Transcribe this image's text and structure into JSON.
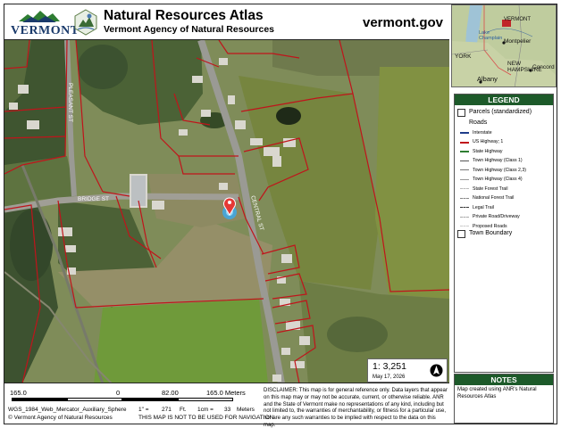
{
  "header": {
    "logo_text": "VERMONT",
    "title": "Natural Resources Atlas",
    "subtitle": "Vermont Agency of Natural Resources",
    "site": "vermont.gov"
  },
  "map": {
    "road_labels": [
      "PLEASANT ST",
      "BRIDGE ST",
      "CENTRAL ST"
    ],
    "scale_ratio": "1: 3,251",
    "date": "May 17, 2026"
  },
  "scalebar": {
    "labels": [
      "165.0",
      "0",
      "82.00",
      "165.0 Meters"
    ],
    "projection": "WGS_1984_Web_Mercator_Auxiliary_Sphere",
    "conversion": [
      "1\" =",
      "271",
      "Ft.",
      "1cm =",
      "33",
      "Meters"
    ],
    "copyright": "© Vermont Agency of Natural Resources",
    "not_for_nav": "THIS MAP IS NOT TO BE USED FOR NAVIGATION"
  },
  "disclaimer": "DISCLAIMER: This map is for general reference only. Data layers that appear on this map may or may not be accurate, current, or otherwise reliable. ANR and the State of Vermont make no representations of any kind, including but not limited to, the warranties of merchantability, or fitness for a particular use, nor are any such warranties to be implied with respect to the data on this map.",
  "locator": {
    "labels": [
      "VERMONT",
      "Lake Champlain",
      "Montpelier",
      "YORK",
      "NEW HAMPSHIRE",
      "Concord",
      "Albany"
    ]
  },
  "legend": {
    "title": "LEGEND",
    "parcels": "Parcels (standardized)",
    "roads_heading": "Roads",
    "roads": [
      {
        "label": "Interstate",
        "color": "#1f3d8a"
      },
      {
        "label": "US Highway; 1",
        "color": "#c0141b"
      },
      {
        "label": "State Highway",
        "color": "#2e7d32"
      },
      {
        "label": "Town Highway (Class 1)",
        "color": "#555555"
      },
      {
        "label": "Town Highway (Class 2,3)",
        "color": "#777777"
      },
      {
        "label": "Town Highway (Class 4)",
        "color": "#999999"
      },
      {
        "label": "State Forest Trail",
        "color": "#bbbbbb"
      },
      {
        "label": "National Forest Trail",
        "color": "#888888"
      },
      {
        "label": "Legal Trail",
        "color": "#333333"
      },
      {
        "label": "Private Road/Driveway",
        "color": "#aaaaaa"
      },
      {
        "label": "Proposed Roads",
        "color": "#cccccc"
      }
    ],
    "town_boundary": "Town Boundary"
  },
  "notes": {
    "title": "NOTES",
    "text": "Map created using ANR's Natural Resources Atlas"
  },
  "colors": {
    "brand_green": "#1d5a2a",
    "parcel_line": "#c0141b",
    "marker": "#e53935"
  }
}
